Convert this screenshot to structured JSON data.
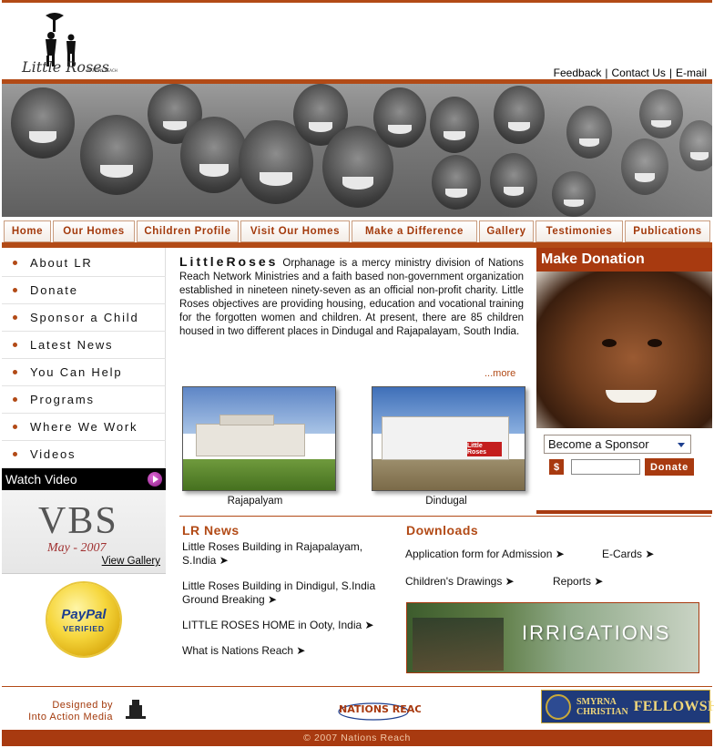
{
  "header": {
    "logo_text": "Little Roses",
    "links": [
      "Feedback",
      "Contact Us",
      "E-mail"
    ],
    "separator": "|"
  },
  "nav": {
    "tabs": [
      "Home",
      "Our Homes",
      "Children Profile",
      "Visit Our Homes",
      "Make a Difference",
      "Gallery",
      "Testimonies",
      "Publications"
    ]
  },
  "sidebar": {
    "items": [
      "About LR",
      "Donate",
      "Sponsor a Child",
      "Latest News",
      "You Can Help",
      "Programs",
      "Where We Work",
      "Videos"
    ],
    "watch_video": "Watch Video",
    "vbs_title": "VBS",
    "vbs_subtitle": "May - 2007",
    "vbs_link": "View Gallery",
    "paypal_name": "PayPal",
    "paypal_verified": "VERIFIED"
  },
  "intro": {
    "brand": "LittleRoses",
    "text": " Orphanage is a mercy ministry division of Nations Reach Network Ministries and a faith based non-government organization established in nineteen ninety-seven as an official non-profit charity. Little Roses objectives are providing housing, education and vocational training for the forgotten women and children. At present, there are 85 children housed in two different places in Dindugal and Rajapalayam, South India.",
    "more": "...more"
  },
  "photos": {
    "left_caption": "Rajapalyam",
    "right_caption": "Dindugal",
    "sign_text": "Little Roses"
  },
  "donation": {
    "title": "Make Donation",
    "select_value": "Become a Sponsor",
    "currency": "$",
    "amount_value": "",
    "button": "Donate"
  },
  "news": {
    "title": "LR News",
    "items": [
      "Little Roses Building in Rajapalayam, S.India ➤",
      "Little Roses Building in Dindigul, S.India Ground Breaking ➤",
      "LITTLE ROSES HOME in Ooty, India ➤",
      "What is Nations Reach ➤"
    ]
  },
  "downloads": {
    "title": "Downloads",
    "items": [
      "Application form for Admission ➤",
      "E-Cards ➤",
      "Children's Drawings ➤",
      "Reports ➤"
    ],
    "banner_text": "IRRIGATIONS"
  },
  "footer": {
    "designed_by": "Designed by",
    "designer": "Into Action Media",
    "partner_logo": "NATIONS REACH",
    "smyrna_line1": "SMYRNA",
    "smyrna_line2": "CHRISTIAN",
    "smyrna_big": "FELLOWSHIP",
    "copyright": "© 2007 Nations Reach"
  }
}
